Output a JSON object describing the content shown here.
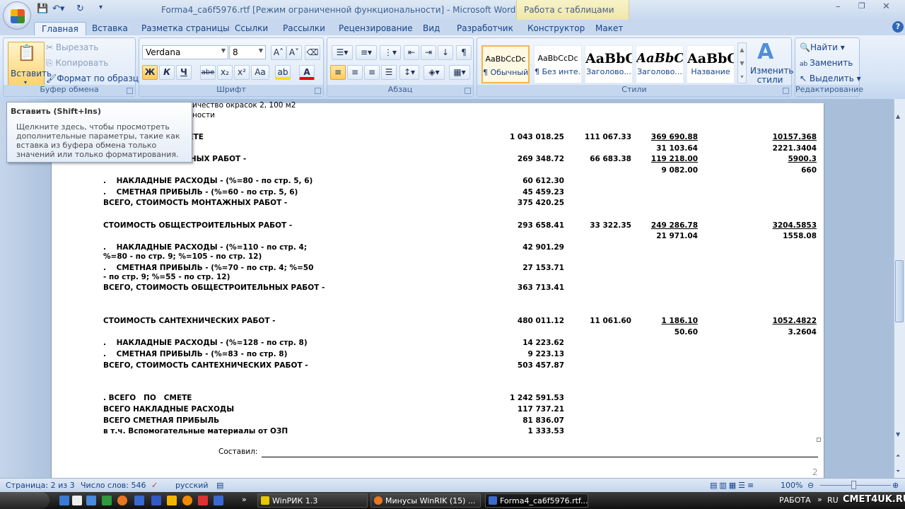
{
  "window": {
    "title": "Forma4_ca6f5976.rtf [Режим ограниченной функциональности] - Microsoft Word",
    "context_title": "Работа с таблицами"
  },
  "tabs": [
    "Главная",
    "Вставка",
    "Разметка страницы",
    "Ссылки",
    "Рассылки",
    "Рецензирование",
    "Вид",
    "Разработчик",
    "Конструктор",
    "Макет"
  ],
  "clipboard": {
    "paste": "Вставить",
    "cut": "Вырезать",
    "copy": "Копировать",
    "format_painter": "Формат по образцу",
    "group": "Буфер обмена"
  },
  "font": {
    "name": "Verdana",
    "size": "8",
    "group": "Шрифт",
    "bold": "Ж",
    "italic": "К",
    "underline": "Ч",
    "strike": "abe",
    "sub": "x₂",
    "sup": "x²",
    "case": "Aa",
    "grow": "A˄",
    "shrink": "A˅"
  },
  "paragraph": {
    "group": "Абзац"
  },
  "styles": {
    "group": "Стили",
    "change": "Изменить стили",
    "items": [
      {
        "preview": "AaBbCcDc",
        "name": "¶ Обычный"
      },
      {
        "preview": "AaBbCcDc",
        "name": "¶ Без инте..."
      },
      {
        "preview": "AaBbC",
        "name": "Заголово..."
      },
      {
        "preview": "AaBbC",
        "name": "Заголово..."
      },
      {
        "preview": "AaBbC",
        "name": "Название"
      }
    ]
  },
  "editing": {
    "group": "Редактирование",
    "find": "Найти",
    "replace": "Заменить",
    "select": "Выделить"
  },
  "tooltip": {
    "title": "Вставить (Shift+Ins)",
    "body": "Щелкните здесь, чтобы просмотреть дополнительные параметры, такие как вставка из буфера обмена только значений или только форматирования."
  },
  "document": {
    "top_lines": [
      "ичество окрасок 2, 100 м2",
      "ности"
    ],
    "rows": [
      {
        "label": "МЕТЕ",
        "c1": "1 043 018.25",
        "c2": "111 067.33",
        "c3": "369 690.88",
        "c4": "10157.368",
        "u": true
      },
      {
        "label": "",
        "c3": "31 103.64",
        "c4": "2221.3404"
      },
      {
        "label": "ЖНЫХ РАБОТ -",
        "c1": "269 348.72",
        "c2": "66 683.38",
        "c3": "119 218.00",
        "c4": "5900.3",
        "u": true
      },
      {
        "label": "",
        "c3": "9 082.00",
        "c4": "660"
      },
      {
        "label": ".    НАКЛАДНЫЕ РАСХОДЫ - (%=80 - по стр. 5, 6)",
        "c1": "60 612.30"
      },
      {
        "label": ".    СМЕТНАЯ ПРИБЫЛЬ - (%=60 - по стр. 5, 6)",
        "c1": "45 459.23"
      },
      {
        "label": "ВСЕГО, СТОИМОСТЬ МОНТАЖНЫХ РАБОТ -",
        "c1": "375 420.25"
      },
      {
        "label": "СТОИМОСТЬ ОБЩЕСТРОИТЕЛЬНЫХ РАБОТ -",
        "c1": "293 658.41",
        "c2": "33 322.35",
        "c3": "249 286.78",
        "c4": "3204.5853",
        "u": true
      },
      {
        "label": "",
        "c3": "21 971.04",
        "c4": "1558.08"
      },
      {
        "label": ".    НАКЛАДНЫЕ РАСХОДЫ - (%=110 - по стр. 4;",
        "c1": "42 901.29"
      },
      {
        "label": "%=80 - по стр. 9; %=105 - по стр. 12)"
      },
      {
        "label": ".    СМЕТНАЯ ПРИБЫЛЬ - (%=70 - по стр. 4; %=50",
        "c1": "27 153.71"
      },
      {
        "label": "- по стр. 9; %=55 - по стр. 12)"
      },
      {
        "label": "ВСЕГО, СТОИМОСТЬ ОБЩЕСТРОИТЕЛЬНЫХ РАБОТ -",
        "c1": "363 713.41"
      },
      {
        "label": "СТОИМОСТЬ САНТЕХНИЧЕСКИХ РАБОТ -",
        "c1": "480 011.12",
        "c2": "11 061.60",
        "c3": "1 186.10",
        "c4": "1052.4822",
        "u": true
      },
      {
        "label": "",
        "c3": "50.60",
        "c4": "3.2604"
      },
      {
        "label": ".    НАКЛАДНЫЕ РАСХОДЫ - (%=128 - по стр. 8)",
        "c1": "14 223.62"
      },
      {
        "label": ".    СМЕТНАЯ ПРИБЫЛЬ - (%=83 - по стр. 8)",
        "c1": "9 223.13"
      },
      {
        "label": "ВСЕГО, СТОИМОСТЬ САНТЕХНИЧЕСКИХ РАБОТ -",
        "c1": "503 457.87"
      },
      {
        "label": ". ВСЕГО   ПО   СМЕТЕ",
        "c1": "1 242 591.53"
      },
      {
        "label": "ВСЕГО НАКЛАДНЫЕ РАСХОДЫ",
        "c1": "117 737.21"
      },
      {
        "label": "ВСЕГО СМЕТНАЯ ПРИБЫЛЬ",
        "c1": "81 836.07"
      },
      {
        "label": "в т.ч. Вспомогательные материалы от ОЗП",
        "c1": "1 333.53"
      }
    ],
    "signed": "Составил:",
    "page_number": "2"
  },
  "status": {
    "page": "Страница: 2 из 3",
    "words": "Число слов: 546",
    "language": "русский",
    "zoom": "100%"
  },
  "taskbar": {
    "items": [
      "WinРИК 1.3",
      "Минусы WinRIK (15) ...",
      "Forma4_ca6f5976.rtf..."
    ],
    "work": "РАБОТА",
    "lang": "RU",
    "watermark": "СМЕТ4UK.RU"
  }
}
